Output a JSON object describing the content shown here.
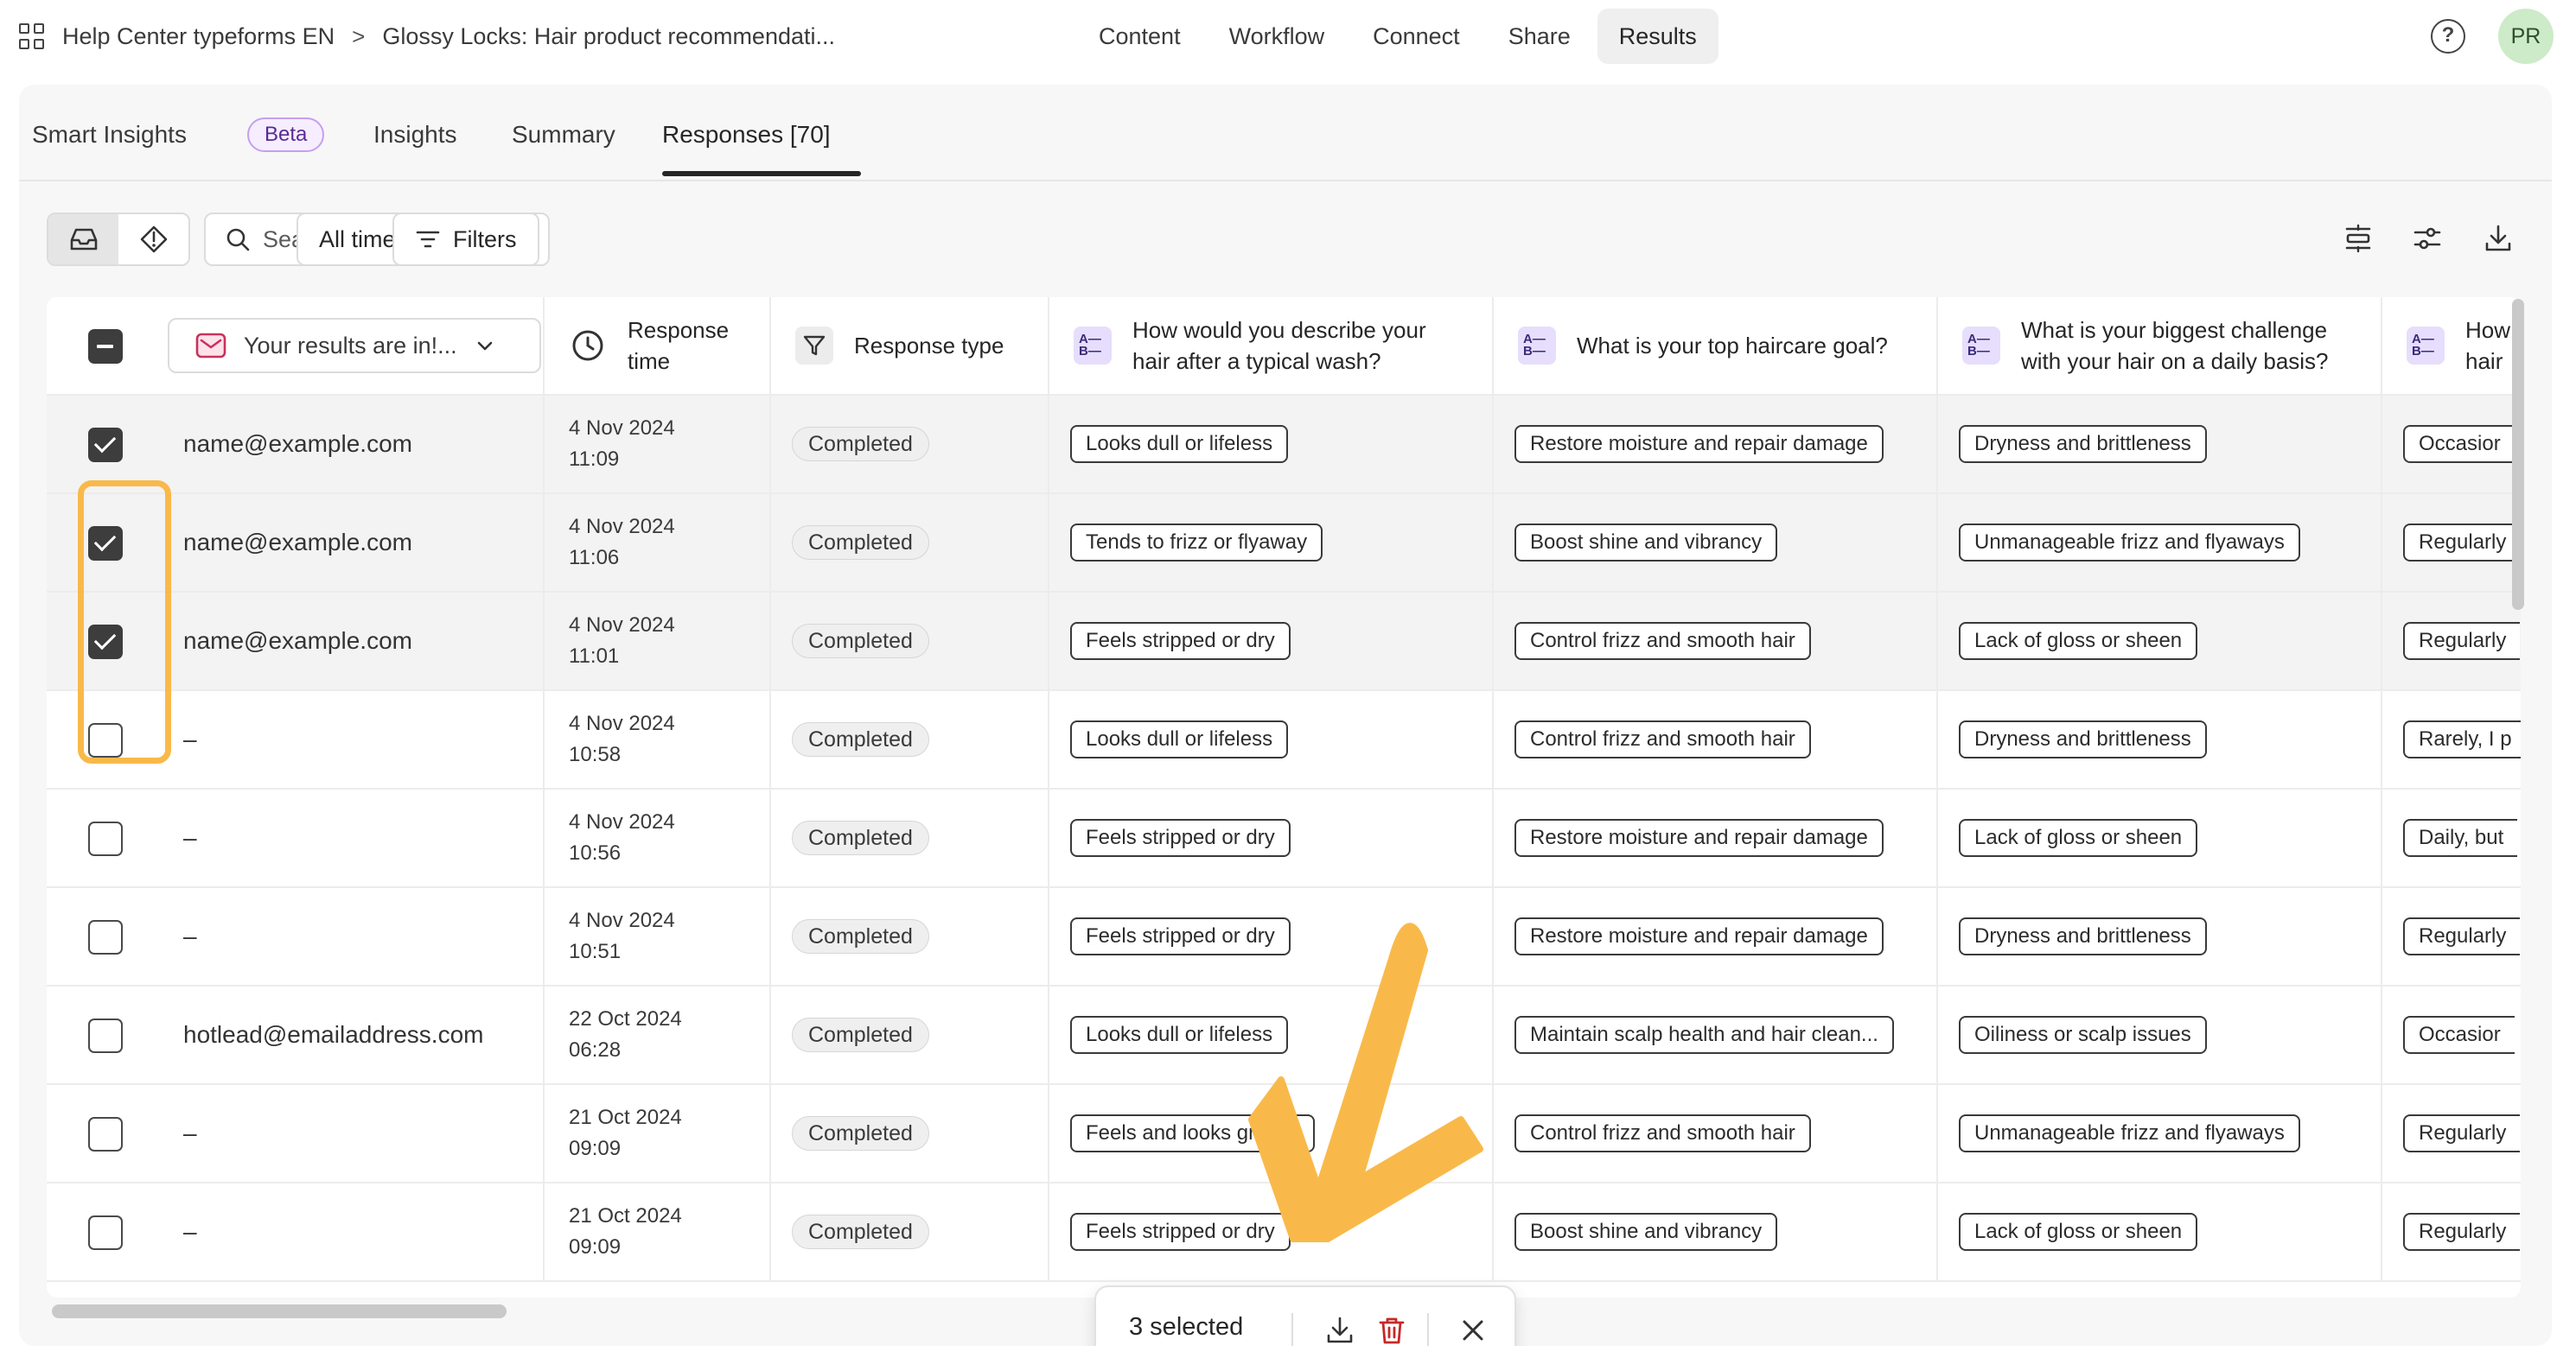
{
  "breadcrumb": {
    "workspace": "Help Center typeforms EN",
    "separator": ">",
    "form": "Glossy Locks: Hair product recommendati..."
  },
  "nav": [
    "Content",
    "Workflow",
    "Connect",
    "Share",
    "Results"
  ],
  "nav_active": "Results",
  "user": {
    "initials": "PR"
  },
  "subtabs": {
    "smart_insights": "Smart Insights",
    "beta": "Beta",
    "insights": "Insights",
    "summary": "Summary",
    "responses": "Responses [70]"
  },
  "toolbar": {
    "search_placeholder": "Search responses",
    "time_filter": "All time",
    "filters": "Filters"
  },
  "table": {
    "email_column_label": "Your results are in!...",
    "headers": {
      "response_time": [
        "Response",
        "time"
      ],
      "response_type": "Response type",
      "q1": [
        "How would you describe your",
        "hair after a typical wash?"
      ],
      "q2": "What is your top haircare goal?",
      "q3": [
        "What is your biggest challenge",
        "with your hair on a daily basis?"
      ],
      "q4": [
        "How",
        "hair"
      ]
    },
    "rows": [
      {
        "selected": true,
        "email": "name@example.com",
        "date": "4 Nov 2024",
        "time": "11:09",
        "status": "Completed",
        "q1": "Looks dull or lifeless",
        "q2": "Restore moisture and repair damage",
        "q3": "Dryness and brittleness",
        "q4": "Occasior"
      },
      {
        "selected": true,
        "email": "name@example.com",
        "date": "4 Nov 2024",
        "time": "11:06",
        "status": "Completed",
        "q1": "Tends to frizz or flyaway",
        "q2": "Boost shine and vibrancy",
        "q3": "Unmanageable frizz and flyaways",
        "q4": "Regularly"
      },
      {
        "selected": true,
        "email": "name@example.com",
        "date": "4 Nov 2024",
        "time": "11:01",
        "status": "Completed",
        "q1": "Feels stripped or dry",
        "q2": "Control frizz and smooth hair",
        "q3": "Lack of gloss or sheen",
        "q4": "Regularly"
      },
      {
        "selected": false,
        "email": "–",
        "date": "4 Nov 2024",
        "time": "10:58",
        "status": "Completed",
        "q1": "Looks dull or lifeless",
        "q2": "Control frizz and smooth hair",
        "q3": "Dryness and brittleness",
        "q4": "Rarely, I p"
      },
      {
        "selected": false,
        "email": "–",
        "date": "4 Nov 2024",
        "time": "10:56",
        "status": "Completed",
        "q1": "Feels stripped or dry",
        "q2": "Restore moisture and repair damage",
        "q3": "Lack of gloss or sheen",
        "q4": "Daily, but"
      },
      {
        "selected": false,
        "email": "–",
        "date": "4 Nov 2024",
        "time": "10:51",
        "status": "Completed",
        "q1": "Feels stripped or dry",
        "q2": "Restore moisture and repair damage",
        "q3": "Dryness and brittleness",
        "q4": "Regularly"
      },
      {
        "selected": false,
        "email": "hotlead@emailaddress.com",
        "date": "22 Oct 2024",
        "time": "06:28",
        "status": "Completed",
        "q1": "Looks dull or lifeless",
        "q2": "Maintain scalp health and hair clean...",
        "q3": "Oiliness or scalp issues",
        "q4": "Occasior"
      },
      {
        "selected": false,
        "email": "–",
        "date": "21 Oct 2024",
        "time": "09:09",
        "status": "Completed",
        "q1": "Feels and looks greasy",
        "q2": "Control frizz and smooth hair",
        "q3": "Unmanageable frizz and flyaways",
        "q4": "Regularly"
      },
      {
        "selected": false,
        "email": "–",
        "date": "21 Oct 2024",
        "time": "09:09",
        "status": "Completed",
        "q1": "Feels stripped or dry",
        "q2": "Boost shine and vibrancy",
        "q3": "Lack of gloss or sheen",
        "q4": "Regularly"
      }
    ]
  },
  "selection_bar": {
    "label": "3 selected"
  },
  "colors": {
    "highlight": "#f9b94a",
    "avatar_bg": "#cdebc8",
    "beta_border": "#c79ef0",
    "question_icon_bg": "#e6defc"
  },
  "icons": [
    "grid-icon",
    "help-icon",
    "inbox-icon",
    "insight-diamond-icon",
    "search-icon",
    "calendar-icon",
    "filter-icon",
    "row-height-icon",
    "settings-sliders-icon",
    "download-icon",
    "mail-icon",
    "chevron-down-icon",
    "clock-icon",
    "funnel-icon",
    "multiple-choice-icon",
    "trash-icon",
    "close-icon",
    "checkmark-arrow-annotation"
  ]
}
